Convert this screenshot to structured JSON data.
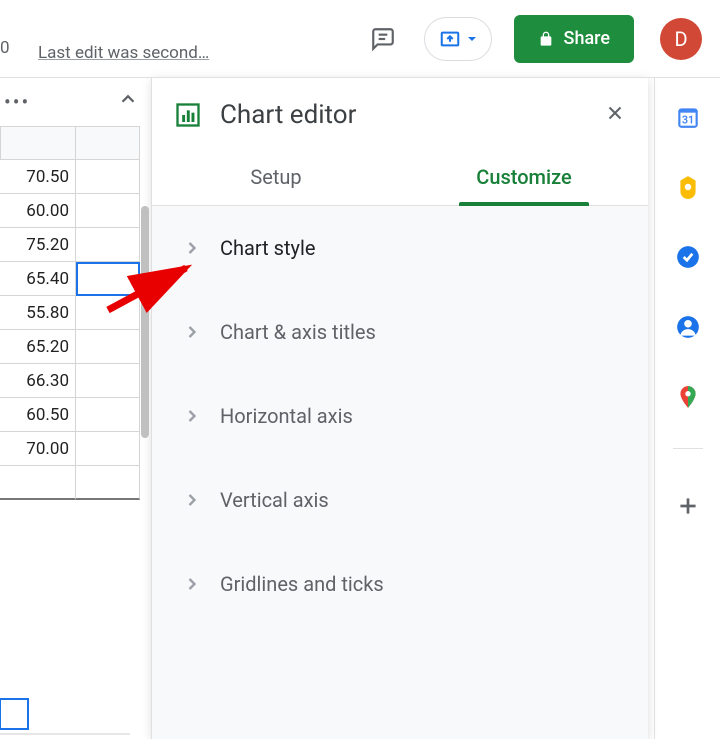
{
  "header": {
    "last_edit": "Last edit was second…",
    "share_label": "Share",
    "avatar_letter": "D",
    "zero": "0"
  },
  "editor": {
    "title": "Chart editor",
    "tabs": {
      "setup": "Setup",
      "customize": "Customize"
    },
    "sections": {
      "chart_style": "Chart style",
      "axis_titles": "Chart & axis titles",
      "horizontal_axis": "Horizontal axis",
      "vertical_axis": "Vertical axis",
      "gridlines": "Gridlines and ticks"
    }
  },
  "sheet": {
    "values": [
      "70.50",
      "60.00",
      "75.20",
      "65.40",
      "55.80",
      "65.20",
      "66.30",
      "60.50",
      "70.00"
    ]
  },
  "ellipsis": "•••"
}
